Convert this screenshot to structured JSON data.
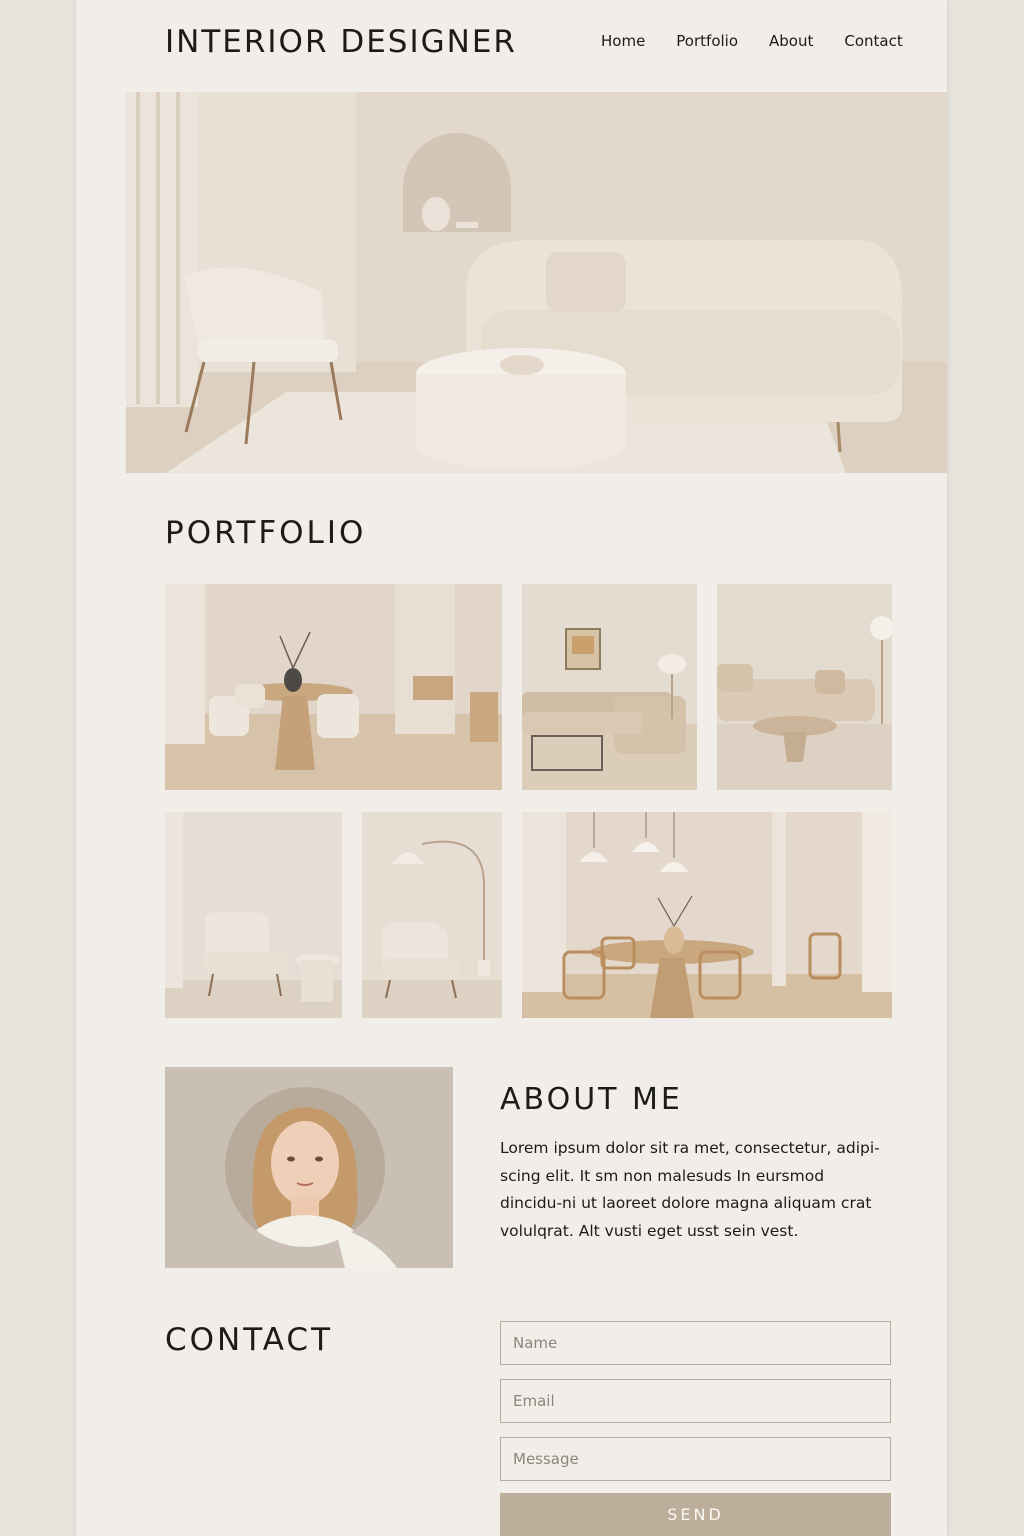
{
  "header": {
    "brand": "INTERIOR DESIGNER",
    "nav": [
      "Home",
      "Portfolio",
      "About",
      "Contact"
    ]
  },
  "portfolio": {
    "title": "PORTFOLIO"
  },
  "about": {
    "title": "ABOUT ME",
    "text": "Lorem ipsum dolor sit ra met, consectetur, adipi-scing elit.  It sm non malesuds In eursmod dincidu-ni ut laoreet dolore magna aliquam crat volulqrat. Alt vusti eget usst sein vest."
  },
  "contact": {
    "title": "CONTACT",
    "name_placeholder": "Name",
    "email_placeholder": "Email",
    "message_placeholder": "Message",
    "send_label": "SEND"
  },
  "colors": {
    "page_bg": "#f1eee9",
    "outer_bg": "#e6e2dc",
    "accent": "#bcae9b",
    "text": "#1d1b19"
  }
}
